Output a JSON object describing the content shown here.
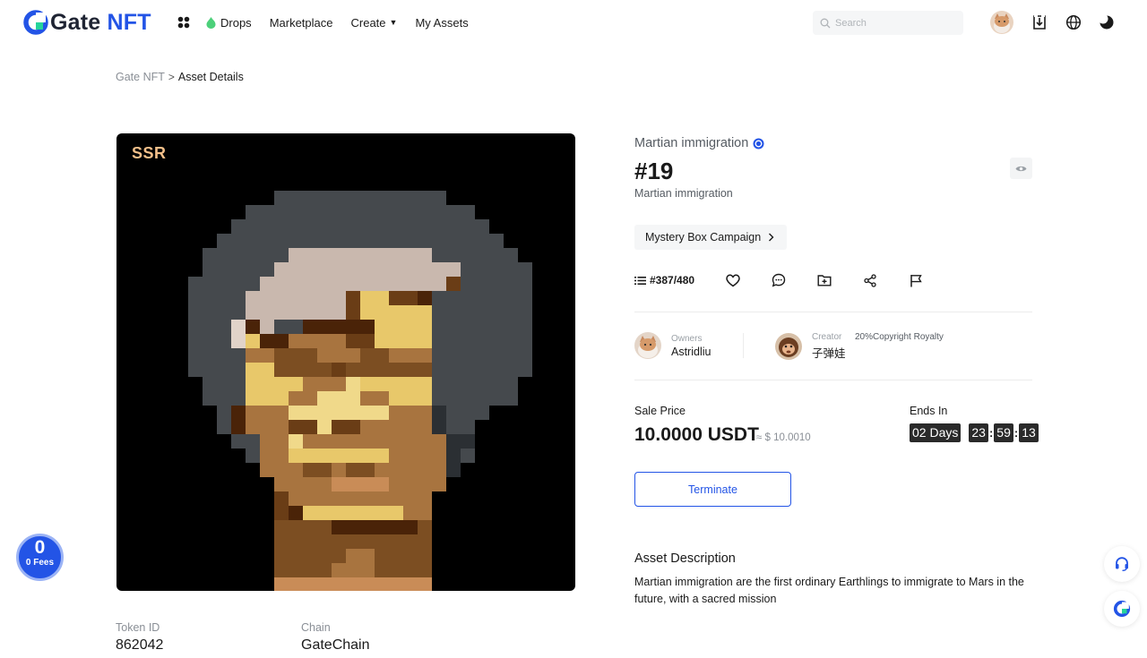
{
  "header": {
    "logo_text": "Gate",
    "logo_accent": "NFT",
    "nav": {
      "drops": "Drops",
      "marketplace": "Marketplace",
      "create": "Create",
      "my_assets": "My Assets"
    },
    "search_placeholder": "Search"
  },
  "breadcrumb": {
    "root": "Gate NFT",
    "separator": ">",
    "current": "Asset Details"
  },
  "artwork": {
    "rarity": "SSR"
  },
  "token": {
    "token_id_label": "Token ID",
    "token_id": "862042",
    "chain_label": "Chain",
    "chain": "GateChain"
  },
  "asset": {
    "collection": "Martian immigration",
    "title": "#19",
    "subtitle": "Martian immigration",
    "campaign": "Mystery Box Campaign",
    "edition": "#387/480"
  },
  "owner": {
    "label": "Owners",
    "name": "Astridliu"
  },
  "creator": {
    "label": "Creator",
    "name": "子弹娃",
    "royalty": "20%Copyright Royalty"
  },
  "sale": {
    "price_label": "Sale Price",
    "price": "10.0000 USDT",
    "price_usd": "≈ $ 10.0010",
    "ends_label": "Ends In",
    "days": "02 Days",
    "hours": "23",
    "minutes": "59",
    "seconds": "13",
    "terminate_label": "Terminate"
  },
  "description": {
    "title": "Asset Description",
    "text": "Martian immigration are the first ordinary Earthlings to immigrate to Mars in the future, with a sacred mission"
  },
  "fees_badge": {
    "number": "0",
    "label": "0 Fees"
  },
  "colors": {
    "brand_blue": "#2354e6",
    "drops_green": "#4cd07a"
  }
}
